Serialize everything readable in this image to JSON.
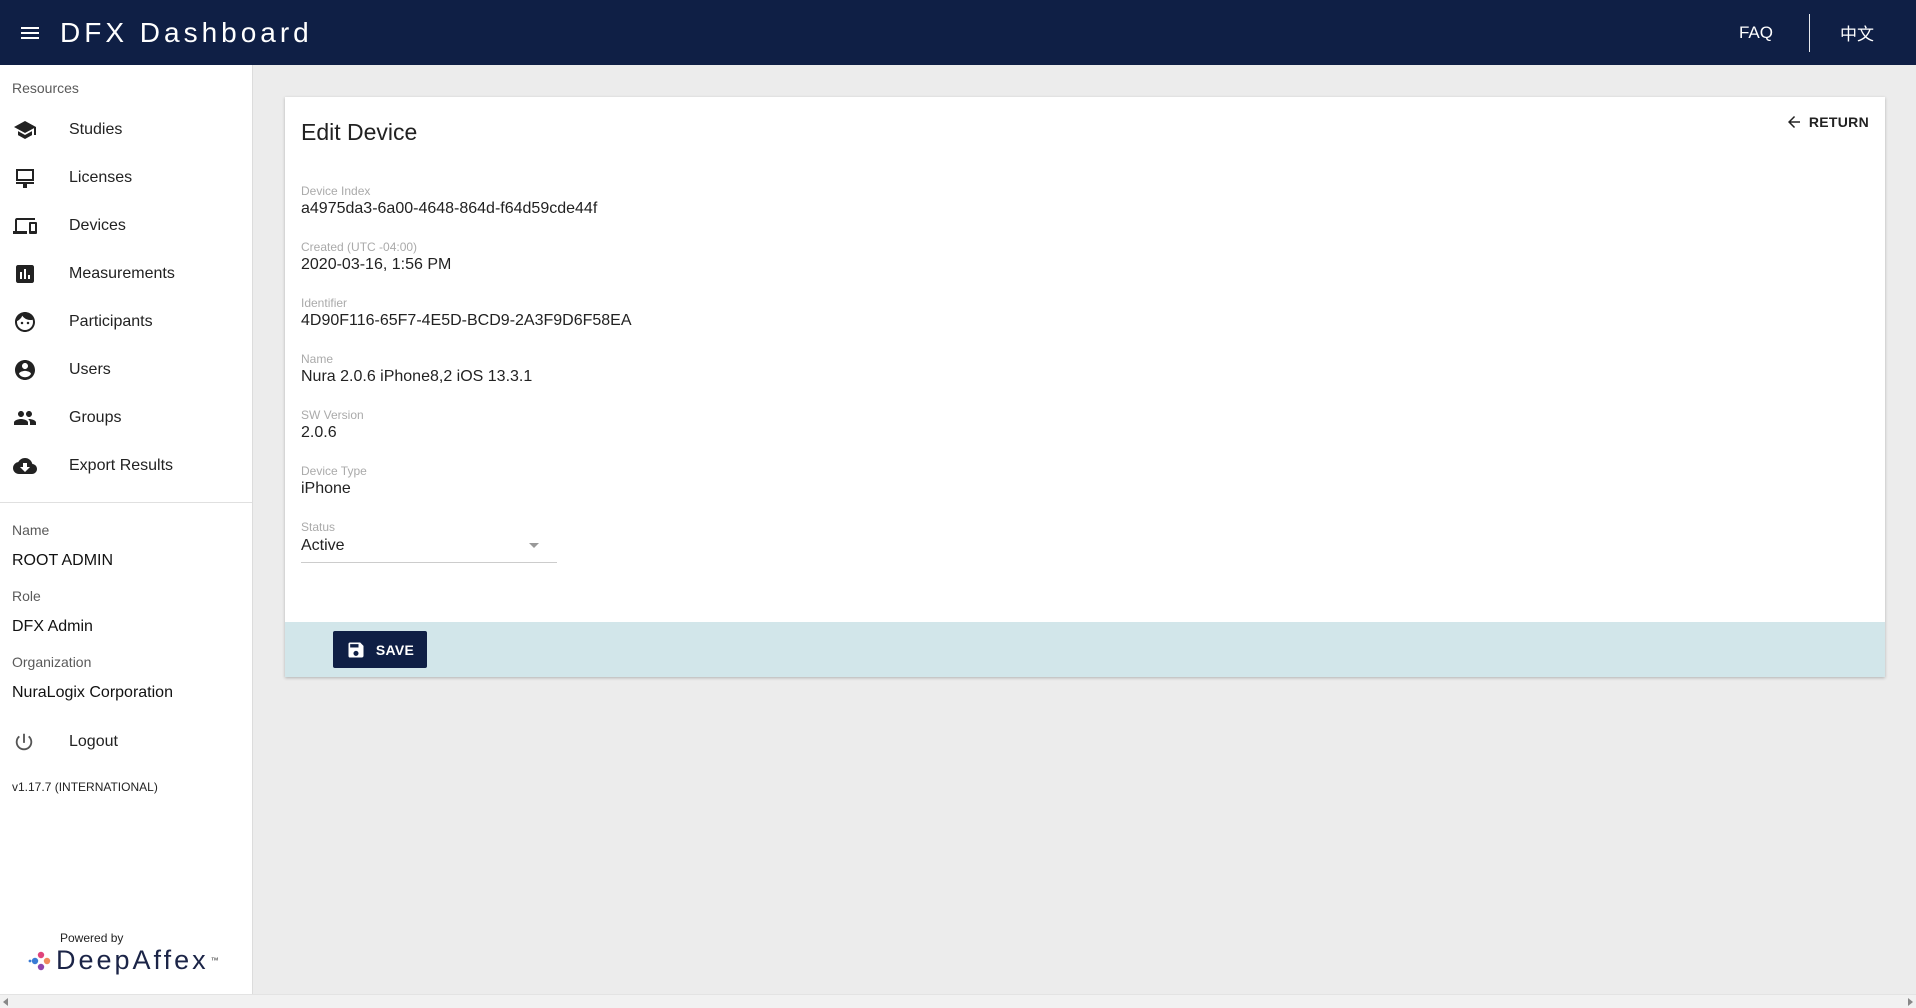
{
  "header": {
    "title": "DFX Dashboard",
    "faq": "FAQ",
    "language": "中文"
  },
  "sidebar": {
    "section_label": "Resources",
    "items": [
      {
        "label": "Studies",
        "icon": "school-icon"
      },
      {
        "label": "Licenses",
        "icon": "license-icon"
      },
      {
        "label": "Devices",
        "icon": "devices-icon"
      },
      {
        "label": "Measurements",
        "icon": "bar-chart-icon"
      },
      {
        "label": "Participants",
        "icon": "face-icon"
      },
      {
        "label": "Users",
        "icon": "account-circle-icon"
      },
      {
        "label": "Groups",
        "icon": "people-icon"
      },
      {
        "label": "Export Results",
        "icon": "cloud-download-icon"
      }
    ],
    "name_label": "Name",
    "name_value": "ROOT ADMIN",
    "role_label": "Role",
    "role_value": "DFX Admin",
    "org_label": "Organization",
    "org_value": "NuraLogix Corporation",
    "logout": "Logout",
    "version": "v1.17.7 (INTERNATIONAL)",
    "powered_by": "Powered by",
    "brand": "DeepAffex",
    "tm": "™"
  },
  "card": {
    "title": "Edit Device",
    "return_label": "RETURN",
    "fields": [
      {
        "label": "Device Index",
        "value": "a4975da3-6a00-4648-864d-f64d59cde44f"
      },
      {
        "label": "Created (UTC -04:00)",
        "value": "2020-03-16, 1:56 PM"
      },
      {
        "label": "Identifier",
        "value": "4D90F116-65F7-4E5D-BCD9-2A3F9D6F58EA"
      },
      {
        "label": "Name",
        "value": "Nura 2.0.6 iPhone8,2 iOS 13.3.1"
      },
      {
        "label": "SW Version",
        "value": "2.0.6"
      },
      {
        "label": "Device Type",
        "value": "iPhone"
      }
    ],
    "status_label": "Status",
    "status_value": "Active",
    "save_label": "SAVE"
  },
  "colors": {
    "appbar": "#0f1f45",
    "footer_bar": "#d2e6ea",
    "background": "#ececec"
  }
}
